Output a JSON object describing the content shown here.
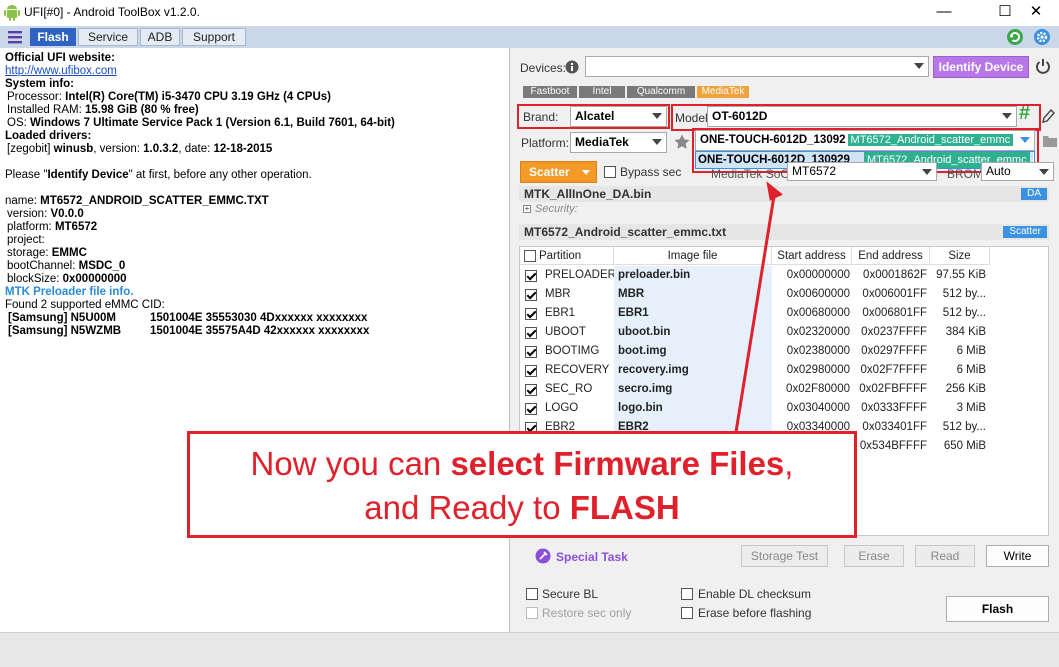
{
  "window": {
    "title": "UFI[#0] - Android ToolBox v1.2.0.",
    "minimize": "—",
    "maximize": "☐",
    "close": "✕"
  },
  "tabs": [
    {
      "label": "Flash",
      "active": true
    },
    {
      "label": "Service"
    },
    {
      "label": "ADB"
    },
    {
      "label": "Support"
    }
  ],
  "log": {
    "website_heading": "Official UFI website:",
    "website_url": "http://www.ufibox.com",
    "sysinfo_heading": "System info:",
    "processor_label": "Processor: ",
    "processor_value": "Intel(R) Core(TM) i5-3470 CPU 3.19 GHz (4 CPUs)",
    "ram_label": "Installed RAM: ",
    "ram_value": "15.98 GiB (80 % free)",
    "os_label": "OS: ",
    "os_value": "Windows 7 Ultimate Service Pack 1 (Version 6.1, Build 7601, 64-bit)",
    "drivers_heading": "Loaded drivers:",
    "driver_prefix": "[zegobit] ",
    "driver_name": "winusb",
    "driver_version_label": ", version: ",
    "driver_version": "1.0.3.2",
    "driver_date_label": ", date: ",
    "driver_date": "12-18-2015",
    "please_pre": "Please \"",
    "please_bold": "Identify Device",
    "please_post": "\" at first, before any other operation.",
    "name_label": "name: ",
    "name_value": "MT6572_ANDROID_SCATTER_EMMC.TXT",
    "version_label": "version: ",
    "version_value": "V0.0.0",
    "platform_label": "platform: ",
    "platform_value": "MT6572",
    "project_label": "project:",
    "storage_label": "storage: ",
    "storage_value": "EMMC",
    "bootchannel_label": "bootChannel: ",
    "bootchannel_value": "MSDC_0",
    "blocksize_label": "blockSize: ",
    "blocksize_value": "0x00000000",
    "preloader_info": "MTK Preloader file info.",
    "emmc_found": "Found 2 supported eMMC CID:",
    "cid1_vendor": "[Samsung] N5U00M",
    "cid1_value": "1501004E 35553030 4Dxxxxxx xxxxxxxx",
    "cid2_vendor": "[Samsung] N5WZMB",
    "cid2_value": "1501004E 35575A4D 42xxxxxx xxxxxxxx"
  },
  "devices": {
    "label": "Devices:",
    "value": "",
    "identify_label": "Identify Device"
  },
  "mode_tabs": [
    "Fastboot",
    "Intel",
    "Qualcomm",
    "MediaTek"
  ],
  "brand": {
    "label": "Brand:",
    "value": "Alcatel"
  },
  "platform": {
    "label": "Platform:",
    "value": "MediaTek"
  },
  "model": {
    "label": "Model:",
    "value": "OT-6012D",
    "hash": "#"
  },
  "variant": {
    "value": "ONE-TOUCH-6012D_13092",
    "scatter": "MT6572_Android_scatter_emmc",
    "option_value": "ONE-TOUCH-6012D_130929",
    "option_scatter": "MT6572_Android_scatter_emmc"
  },
  "scatter_button": "Scatter",
  "bypass_label": "Bypass sec",
  "soc": {
    "label": "MediaTek SoC:",
    "value": "MT6572"
  },
  "brom": {
    "label": "BROM:",
    "value": "Auto"
  },
  "da_file": {
    "name": "MTK_AllInOne_DA.bin",
    "tag": "DA",
    "security_label": "Security:"
  },
  "scatter_file": {
    "name": "MT6572_Android_scatter_emmc.txt",
    "tag": "Scatter"
  },
  "table": {
    "headers": [
      "Partition",
      "Image file",
      "Start address",
      "End address",
      "Size"
    ],
    "rows": [
      {
        "checked": true,
        "partition": "PRELOADER",
        "image": "preloader.bin",
        "start": "0x00000000",
        "end": "0x0001862F",
        "size": "97.55 KiB"
      },
      {
        "checked": true,
        "partition": "MBR",
        "image": "MBR",
        "start": "0x00600000",
        "end": "0x006001FF",
        "size": "512 by..."
      },
      {
        "checked": true,
        "partition": "EBR1",
        "image": "EBR1",
        "start": "0x00680000",
        "end": "0x006801FF",
        "size": "512 by..."
      },
      {
        "checked": true,
        "partition": "UBOOT",
        "image": "uboot.bin",
        "start": "0x02320000",
        "end": "0x0237FFFF",
        "size": "384 KiB"
      },
      {
        "checked": true,
        "partition": "BOOTIMG",
        "image": "boot.img",
        "start": "0x02380000",
        "end": "0x0297FFFF",
        "size": "6 MiB"
      },
      {
        "checked": true,
        "partition": "RECOVERY",
        "image": "recovery.img",
        "start": "0x02980000",
        "end": "0x02F7FFFF",
        "size": "6 MiB"
      },
      {
        "checked": true,
        "partition": "SEC_RO",
        "image": "secro.img",
        "start": "0x02F80000",
        "end": "0x02FBFFFF",
        "size": "256 KiB"
      },
      {
        "checked": true,
        "partition": "LOGO",
        "image": "logo.bin",
        "start": "0x03040000",
        "end": "0x0333FFFF",
        "size": "3 MiB"
      },
      {
        "checked": true,
        "partition": "EBR2",
        "image": "EBR2",
        "start": "0x03340000",
        "end": "0x033401FF",
        "size": "512 by..."
      },
      {
        "checked": true,
        "partition": "",
        "image": "",
        "start": "",
        "end": "0x534BFFFF",
        "size": "650 MiB"
      }
    ]
  },
  "callout": {
    "line1_pre": "Now you can ",
    "line1_bold": "select Firmware Files",
    "line1_post": ",",
    "line2_pre": "and Ready to ",
    "line2_bold": "FLASH"
  },
  "special_task": "Special Task",
  "actions": {
    "storage_test": "Storage Test",
    "erase": "Erase",
    "read": "Read",
    "write": "Write",
    "flash": "Flash"
  },
  "options": {
    "secure_bl": "Secure BL",
    "restore_sec": "Restore sec only",
    "enable_dl": "Enable DL checksum",
    "erase_before": "Erase before flashing"
  },
  "colors": {
    "accent_blue": "#2f64c4",
    "identify_purple": "#b777e8",
    "callout_red": "#e0202a",
    "mediatek_orange": "#f0a23c",
    "scatter_orange": "#f59a27"
  }
}
